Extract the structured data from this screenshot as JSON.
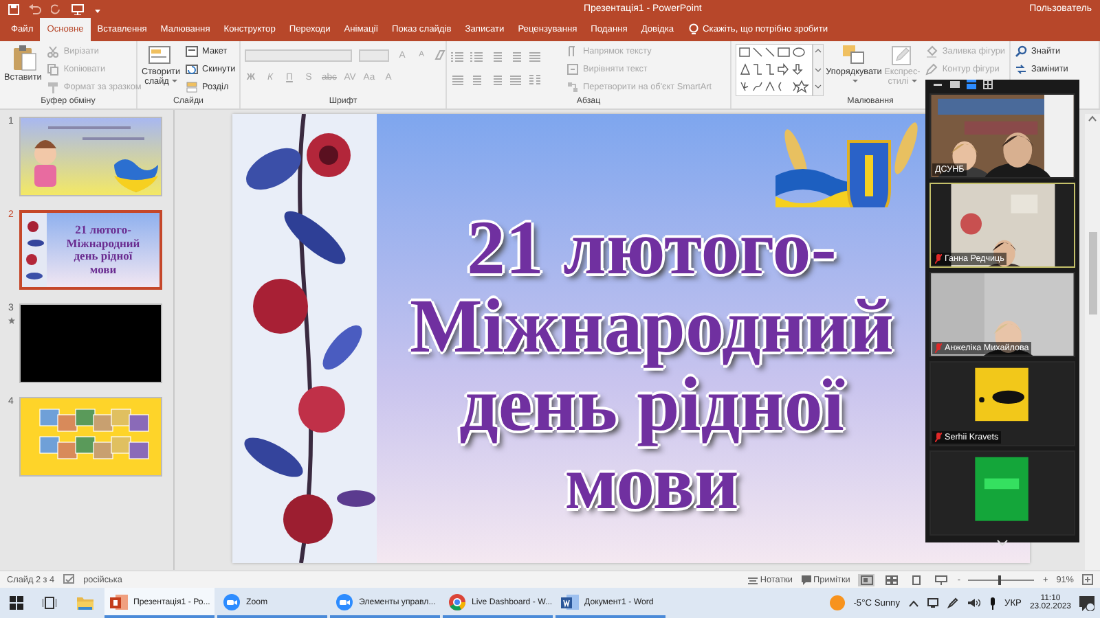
{
  "window": {
    "title": "Презентація1 - PowerPoint",
    "user": "Пользователь"
  },
  "ribbon_tabs": [
    {
      "label": "Файл",
      "selected": false
    },
    {
      "label": "Основне",
      "selected": true
    },
    {
      "label": "Вставлення",
      "selected": false
    },
    {
      "label": "Малювання",
      "selected": false
    },
    {
      "label": "Конструктор",
      "selected": false
    },
    {
      "label": "Переходи",
      "selected": false
    },
    {
      "label": "Анімації",
      "selected": false
    },
    {
      "label": "Показ слайдів",
      "selected": false
    },
    {
      "label": "Записати",
      "selected": false
    },
    {
      "label": "Рецензування",
      "selected": false
    },
    {
      "label": "Подання",
      "selected": false
    },
    {
      "label": "Довідка",
      "selected": false
    }
  ],
  "tell_me": {
    "placeholder": "Скажіть, що потрібно зробити"
  },
  "ribbon": {
    "clipboard": {
      "label": "Буфер обміну",
      "paste": "Вставити",
      "items": [
        {
          "label": "Вирізати",
          "disabled": true
        },
        {
          "label": "Копіювати",
          "disabled": true
        },
        {
          "label": "Формат за зразком",
          "disabled": true
        }
      ]
    },
    "slides": {
      "label": "Слайди",
      "new_slide": "Створити слайд",
      "items": [
        {
          "label": "Макет",
          "disabled": false
        },
        {
          "label": "Скинути",
          "disabled": false
        },
        {
          "label": "Розділ",
          "disabled": false
        }
      ]
    },
    "font": {
      "label": "Шрифт",
      "disabled": true,
      "size_buttons": [
        "A",
        "A"
      ],
      "buttons": [
        "Ж",
        "К",
        "П",
        "S",
        "abc",
        "AV",
        "Aa",
        "A"
      ]
    },
    "paragraph": {
      "label": "Абзац",
      "items": [
        {
          "label": "Напрямок тексту",
          "disabled": true
        },
        {
          "label": "Вирівняти текст",
          "disabled": true
        },
        {
          "label": "Перетворити на об'єкт SmartArt",
          "disabled": true
        }
      ]
    },
    "drawing": {
      "label": "Малювання",
      "arrange": "Упорядкувати",
      "quick_styles": {
        "label": "Експрес-стилі",
        "disabled": true
      },
      "items": [
        {
          "label": "Заливка фігури",
          "disabled": true
        },
        {
          "label": "Контур фігури",
          "disabled": true
        }
      ]
    },
    "editing": {
      "items": [
        {
          "label": "Знайти"
        },
        {
          "label": "Замінити"
        }
      ]
    }
  },
  "thumbnails": [
    {
      "number": "1",
      "kind": "picture",
      "selected": false,
      "animated": false
    },
    {
      "number": "2",
      "kind": "title",
      "selected": true,
      "animated": false,
      "lines": [
        "21 лютого-",
        "Міжнародний",
        "день рідної",
        "мови"
      ]
    },
    {
      "number": "3",
      "kind": "blank",
      "selected": false,
      "animated": true
    },
    {
      "number": "4",
      "kind": "collage",
      "selected": false,
      "animated": false
    }
  ],
  "slide": {
    "title_lines": [
      "21 лютого-",
      "Міжнародний",
      "день рідної",
      "мови"
    ]
  },
  "zoom": {
    "tiles": [
      {
        "name": "ДСУНБ",
        "kind": "video",
        "muted": false,
        "speaking": false
      },
      {
        "name": "Ганна Редчиць",
        "kind": "video",
        "muted": true,
        "speaking": true
      },
      {
        "name": "Анжеліка Михайлова",
        "kind": "video",
        "muted": true,
        "speaking": false
      },
      {
        "name": "Serhii Kravets",
        "kind": "avatar",
        "muted": true,
        "speaking": false
      },
      {
        "kind": "avatar",
        "muted": false,
        "speaking": false
      }
    ]
  },
  "status_bar": {
    "slide_info": "Слайд 2 з 4",
    "language": "російська",
    "notes": "Нотатки",
    "comments": "Примітки",
    "views": [
      {
        "selected": true
      },
      {
        "selected": false
      },
      {
        "selected": false
      },
      {
        "selected": false
      }
    ],
    "zoom_out": "-",
    "zoom_in": "+",
    "zoom_slider": {
      "level": 0.45
    },
    "zoom_level": "91%"
  },
  "taskbar": {
    "apps": [
      {
        "label": "Презентація1 - Ро...",
        "kind": "powerpoint",
        "selected": true
      },
      {
        "label": "Zoom",
        "kind": "zoom",
        "selected": false
      },
      {
        "label": "Элементы управл...",
        "kind": "zoom",
        "selected": false
      },
      {
        "label": "Live Dashboard - W...",
        "kind": "chrome",
        "selected": false
      },
      {
        "label": "Документ1 - Word",
        "kind": "word",
        "selected": false
      }
    ],
    "weather": "-5°C Sunny",
    "language": "УКР",
    "time": "11:10",
    "date": "23.02.2023"
  }
}
